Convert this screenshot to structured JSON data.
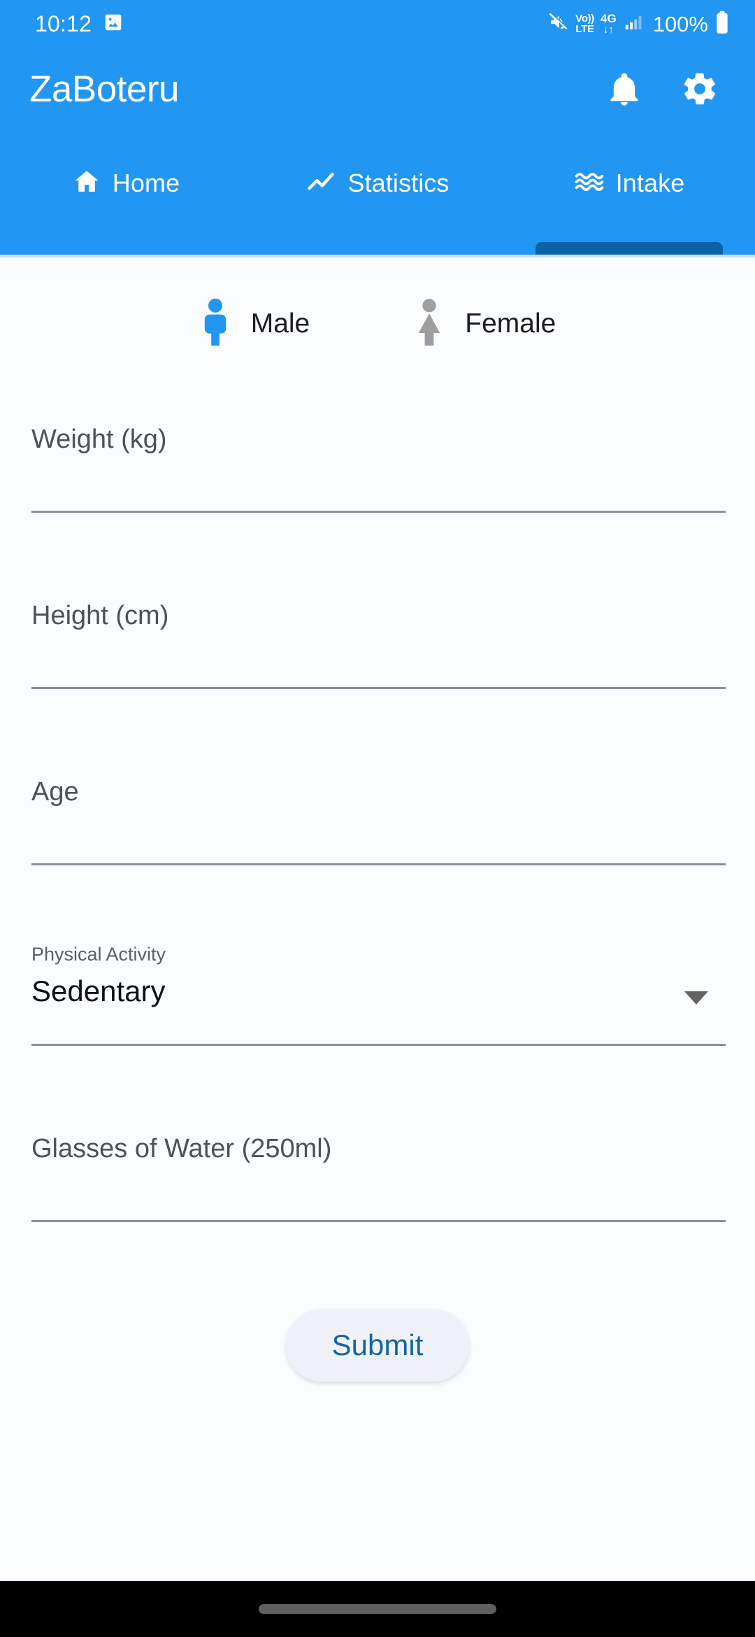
{
  "status_bar": {
    "time": "10:12",
    "photo_icon": "image-icon",
    "mute_icon": "mute-icon",
    "volte_top": "Vo))",
    "volte_bottom": "LTE",
    "network_type": "4G",
    "data_arrows": "↓↑",
    "signal_icon": "signal-bars-icon",
    "battery_percent": "100%",
    "battery_icon": "battery-full-icon"
  },
  "app_bar": {
    "title": "ZaBoteru",
    "notifications_icon": "bell-icon",
    "settings_icon": "gear-icon"
  },
  "tabs": [
    {
      "label": "Home",
      "icon": "home-icon",
      "active": false
    },
    {
      "label": "Statistics",
      "icon": "trending-up-icon",
      "active": false
    },
    {
      "label": "Intake",
      "icon": "waves-icon",
      "active": true
    }
  ],
  "gender": {
    "selected": "Male",
    "options": [
      {
        "label": "Male",
        "icon": "male-figure-icon",
        "selected": true
      },
      {
        "label": "Female",
        "icon": "female-figure-icon",
        "selected": false
      }
    ]
  },
  "form": {
    "weight": {
      "placeholder": "Weight (kg)",
      "value": ""
    },
    "height": {
      "placeholder": "Height (cm)",
      "value": ""
    },
    "age": {
      "placeholder": "Age",
      "value": ""
    },
    "activity": {
      "label": "Physical Activity",
      "value": "Sedentary",
      "dropdown_icon": "chevron-down-icon"
    },
    "glasses": {
      "placeholder": "Glasses of Water (250ml)",
      "value": ""
    },
    "submit_label": "Submit"
  },
  "nav_bar": {
    "gesture_pill": "home-gesture-pill"
  },
  "colors": {
    "brand_blue": "#2196f3",
    "indicator_blue": "#0b63a5",
    "submit_bg": "#eef2f8",
    "submit_text": "#1565a0",
    "gender_selected": "#2196f3",
    "gender_unselected": "#9e9e9e",
    "content_bg": "#fbfcfe",
    "underline": "#8a8f99"
  }
}
